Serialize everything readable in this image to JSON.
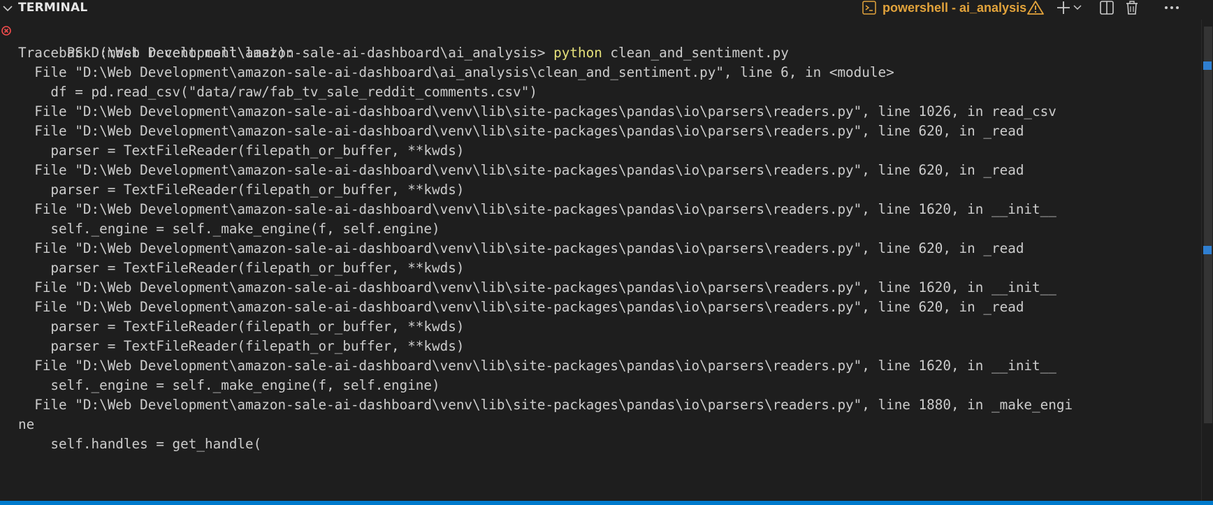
{
  "panel": {
    "title": "TERMINAL",
    "session": {
      "name": "powershell - ai_analysis",
      "status_color": "#e2a33b",
      "warning": true
    },
    "toolbar_icons": [
      "terminal-icon",
      "warning-icon",
      "plus-icon",
      "chevron-down-icon",
      "split-icon",
      "trash-icon",
      "ellipsis-icon"
    ]
  },
  "terminal": {
    "command": {
      "prompt": "PS D:\\Web Development\\amazon-sale-ai-dashboard\\ai_analysis> ",
      "executable": "python",
      "args": " clean_and_sentiment.py",
      "exit_status": "error"
    },
    "output": [
      "Traceback (most recent call last):",
      "  File \"D:\\Web Development\\amazon-sale-ai-dashboard\\ai_analysis\\clean_and_sentiment.py\", line 6, in <module>",
      "    df = pd.read_csv(\"data/raw/fab_tv_sale_reddit_comments.csv\")",
      "  File \"D:\\Web Development\\amazon-sale-ai-dashboard\\venv\\lib\\site-packages\\pandas\\io\\parsers\\readers.py\", line 1026, in read_csv",
      "  File \"D:\\Web Development\\amazon-sale-ai-dashboard\\venv\\lib\\site-packages\\pandas\\io\\parsers\\readers.py\", line 620, in _read",
      "    parser = TextFileReader(filepath_or_buffer, **kwds)",
      "  File \"D:\\Web Development\\amazon-sale-ai-dashboard\\venv\\lib\\site-packages\\pandas\\io\\parsers\\readers.py\", line 620, in _read",
      "    parser = TextFileReader(filepath_or_buffer, **kwds)",
      "  File \"D:\\Web Development\\amazon-sale-ai-dashboard\\venv\\lib\\site-packages\\pandas\\io\\parsers\\readers.py\", line 1620, in __init__",
      "    self._engine = self._make_engine(f, self.engine)",
      "  File \"D:\\Web Development\\amazon-sale-ai-dashboard\\venv\\lib\\site-packages\\pandas\\io\\parsers\\readers.py\", line 620, in _read",
      "    parser = TextFileReader(filepath_or_buffer, **kwds)",
      "  File \"D:\\Web Development\\amazon-sale-ai-dashboard\\venv\\lib\\site-packages\\pandas\\io\\parsers\\readers.py\", line 1620, in __init__",
      "  File \"D:\\Web Development\\amazon-sale-ai-dashboard\\venv\\lib\\site-packages\\pandas\\io\\parsers\\readers.py\", line 620, in _read",
      "    parser = TextFileReader(filepath_or_buffer, **kwds)",
      "    parser = TextFileReader(filepath_or_buffer, **kwds)",
      "  File \"D:\\Web Development\\amazon-sale-ai-dashboard\\venv\\lib\\site-packages\\pandas\\io\\parsers\\readers.py\", line 1620, in __init__",
      "    self._engine = self._make_engine(f, self.engine)",
      "  File \"D:\\Web Development\\amazon-sale-ai-dashboard\\venv\\lib\\site-packages\\pandas\\io\\parsers\\readers.py\", line 1880, in _make_engi",
      "ne",
      "    self.handles = get_handle("
    ]
  },
  "colors": {
    "background": "#1e1e1e",
    "text": "#cccccc",
    "command_highlight": "#e5e07a",
    "error": "#f14c4c",
    "status_bar": "#007acc"
  }
}
